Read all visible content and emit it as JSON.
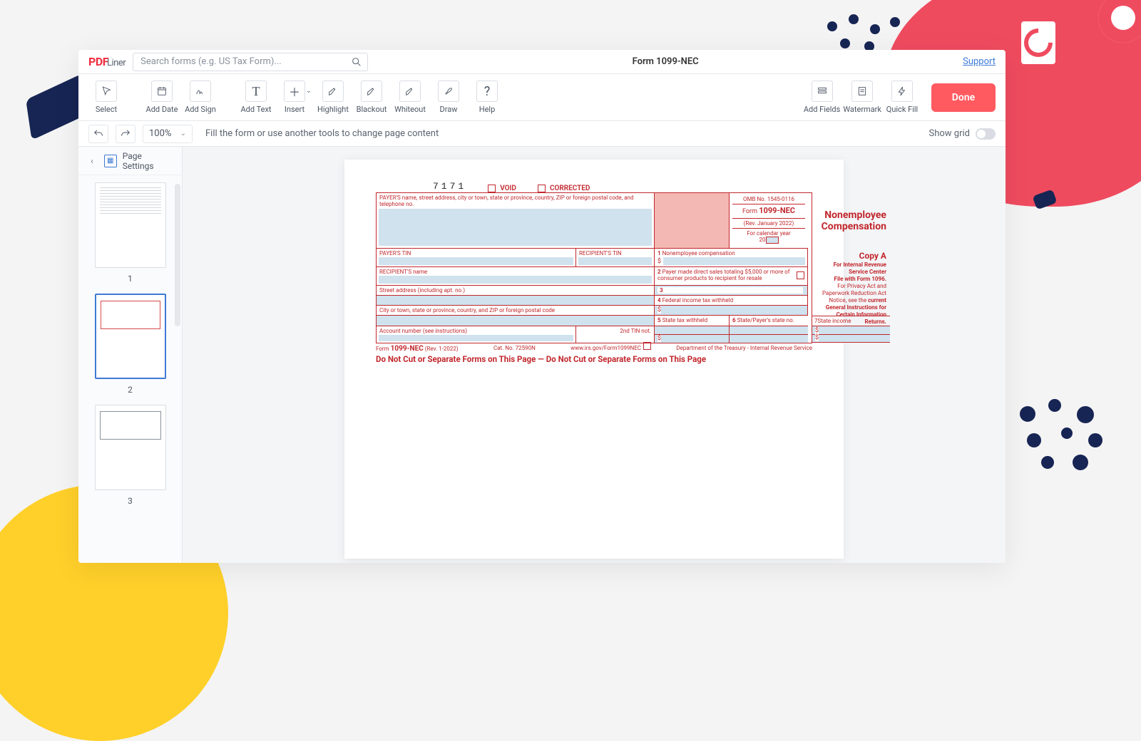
{
  "brand": {
    "pdf": "PDF",
    "liner": "Liner"
  },
  "topbar": {
    "search_placeholder": "Search forms (e.g. US Tax Form)...",
    "doc_title": "Form 1099-NEC",
    "support": "Support"
  },
  "toolbar": {
    "select": "Select",
    "add_date": "Add Date",
    "add_sign": "Add Sign",
    "add_text": "Add Text",
    "insert": "Insert",
    "highlight": "Highlight",
    "blackout": "Blackout",
    "whiteout": "Whiteout",
    "draw": "Draw",
    "help": "Help",
    "add_fields": "Add Fields",
    "watermark": "Watermark",
    "quick_fill": "Quick Fill",
    "done": "Done"
  },
  "subbar": {
    "zoom": "100%",
    "hint": "Fill the form or use another tools to change page content",
    "show_grid": "Show grid"
  },
  "sidebar": {
    "page_settings": "Page Settings",
    "page_1": "1",
    "page_2": "2",
    "page_3": "3"
  },
  "form": {
    "code": "7171",
    "void": "VOID",
    "corrected": "CORRECTED",
    "payer_block": "PAYER'S name, street address, city or town, state or province, country, ZIP or foreign postal code, and telephone no.",
    "omb": "OMB No. 1545-0116",
    "form_label": "Form",
    "form_name": "1099-NEC",
    "rev": "(Rev. January 2022)",
    "cal_year": "For calendar year",
    "year_prefix": "20",
    "title1": "Nonemployee",
    "title2": "Compensation",
    "payers_tin": "PAYER'S TIN",
    "recip_tin": "RECIPIENT'S TIN",
    "box1": "Nonemployee compensation",
    "copy_a": "Copy A",
    "for_irs": "For Internal Revenue Service Center",
    "file_with": "File with Form 1096.",
    "privacy": "For Privacy Act and Paperwork Reduction Act Notice, see the",
    "current": "current General Instructions for Certain Information Returns.",
    "recip_name": "RECIPIENT'S name",
    "box2": "Payer made direct sales totaling $5,000 or more of consumer products to recipient for resale",
    "box3": "3",
    "street": "Street address (including apt. no.)",
    "box4": "Federal income tax withheld",
    "city": "City or town, state or province, country, and ZIP or foreign postal code",
    "box5": "State tax withheld",
    "box6": "State/Payer's state no.",
    "box7": "State income",
    "acct": "Account number (see instructions)",
    "tin2": "2nd TIN not.",
    "foot_form": "Form",
    "foot_name": "1099-NEC",
    "foot_rev": "(Rev. 1-2022)",
    "cat": "Cat. No. 72590N",
    "url": "www.irs.gov/Form1099NEC",
    "dept": "Department of the Treasury - Internal Revenue Service",
    "banner": "Do Not Cut or Separate Forms on This Page   —   Do Not Cut or Separate Forms on This Page"
  }
}
